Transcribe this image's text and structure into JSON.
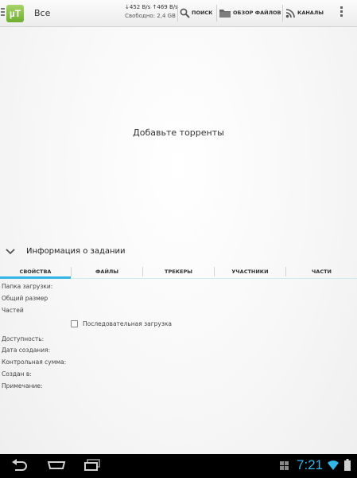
{
  "action_bar": {
    "logo_text": "µT",
    "view_title": "Все",
    "download_speed": "↓452 B/s",
    "upload_speed": "↑469 B/s",
    "free_space": "Свободно: 2,4 GB",
    "search_label": "ПОИСК",
    "files_label": "ОБЗОР ФАЙЛОВ",
    "feeds_label": "КАНАЛЫ",
    "icons": {
      "menu": "menu-lines-icon",
      "search": "search-icon",
      "files": "folder-icon",
      "feeds": "rss-icon",
      "overflow": "overflow-icon"
    }
  },
  "torrent_list": {
    "empty_message": "Добавьте торренты"
  },
  "details": {
    "title": "Информация о задании",
    "tabs": [
      {
        "label": "СВОЙСТВА",
        "active": true
      },
      {
        "label": "ФАЙЛЫ",
        "active": false
      },
      {
        "label": "ТРЕКЕРЫ",
        "active": false
      },
      {
        "label": "УЧАСТНИКИ",
        "active": false
      },
      {
        "label": "ЧАСТИ",
        "active": false
      }
    ],
    "properties": {
      "download_folder": "Папка загрузки:",
      "total_size": "Общий размер",
      "pieces": "Частей",
      "sequential_download": "Последовательная загрузка",
      "sequential_checked": false,
      "availability": "Доступность:",
      "created_date": "Дата создания:",
      "checksum": "Контрольная сумма:",
      "created_by": "Создан в:",
      "comment": "Примечание:"
    }
  },
  "system_bar": {
    "time": "7:21",
    "icons": [
      "back-icon",
      "home-icon",
      "recent-apps-icon",
      "app-notification-icon",
      "wifi-icon",
      "battery-icon"
    ]
  },
  "colors": {
    "accent": "#33b5e5",
    "logo_green": "#7ab83a",
    "system_bar": "#000000"
  }
}
